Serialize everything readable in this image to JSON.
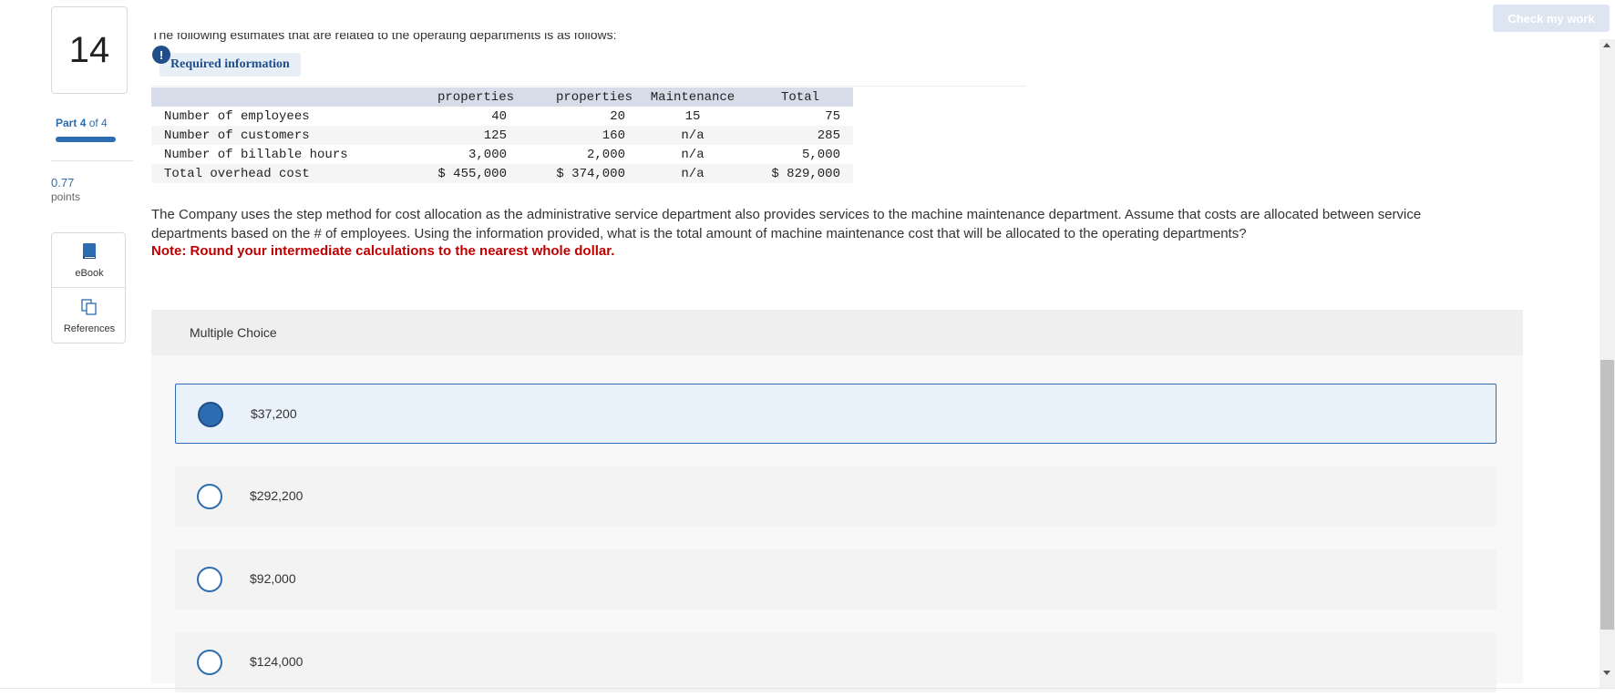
{
  "question_number": "14",
  "part": {
    "prefix": "Part",
    "current": "4",
    "of": "of 4"
  },
  "points": {
    "value": "0.77",
    "label": "points"
  },
  "tools": {
    "ebook": "eBook",
    "references": "References"
  },
  "check_button": "Check my work",
  "intro_text": "The following estimates that are related to the operating departments is as follows:",
  "required_info": {
    "icon": "!",
    "label": "Required information"
  },
  "table": {
    "headers": [
      "",
      "properties",
      "properties",
      "Maintenance",
      "Total"
    ],
    "rows": [
      [
        "Number of employees",
        "40",
        "20",
        "15",
        "75"
      ],
      [
        "Number of customers",
        "125",
        "160",
        "n/a",
        "285"
      ],
      [
        "Number of billable hours",
        "3,000",
        "2,000",
        "n/a",
        "5,000"
      ],
      [
        "Total overhead cost",
        "$ 455,000",
        "$ 374,000",
        "n/a",
        "$ 829,000"
      ]
    ]
  },
  "question": "The Company uses the step method for cost allocation as the administrative service department also provides services to the machine maintenance department. Assume that costs are allocated between service departments based on the # of employees. Using the information provided, what is the total amount of machine maintenance cost that will be allocated to the operating departments?",
  "note": "Note: Round your intermediate calculations to the nearest whole dollar.",
  "multiple_choice": {
    "title": "Multiple Choice",
    "options": [
      {
        "label": "$37,200",
        "selected": true
      },
      {
        "label": "$292,200",
        "selected": false
      },
      {
        "label": "$92,000",
        "selected": false
      },
      {
        "label": "$124,000",
        "selected": false
      }
    ]
  },
  "colors": {
    "accent": "#2c6cb0",
    "note": "#c00000",
    "table_header": "#d6dde8"
  }
}
